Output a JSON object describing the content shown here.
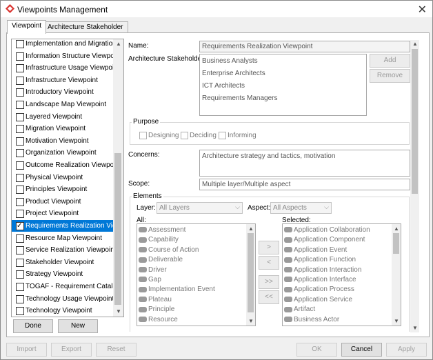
{
  "window": {
    "title": "Viewpoints Management"
  },
  "tabs": [
    "Viewpoint",
    "Architecture Stakeholder"
  ],
  "viewpoint_list": [
    {
      "label": "Implementation and Migration ...",
      "checked": false
    },
    {
      "label": "Information Structure Viewpoint",
      "checked": false
    },
    {
      "label": "Infrastructure Usage Viewpoint",
      "checked": false
    },
    {
      "label": "Infrastructure Viewpoint",
      "checked": false
    },
    {
      "label": "Introductory Viewpoint",
      "checked": false
    },
    {
      "label": "Landscape Map Viewpoint",
      "checked": false
    },
    {
      "label": "Layered Viewpoint",
      "checked": false
    },
    {
      "label": "Migration Viewpoint",
      "checked": false
    },
    {
      "label": "Motivation Viewpoint",
      "checked": false
    },
    {
      "label": "Organization Viewpoint",
      "checked": false
    },
    {
      "label": "Outcome Realization Viewpoint",
      "checked": false
    },
    {
      "label": "Physical Viewpoint",
      "checked": false
    },
    {
      "label": "Principles Viewpoint",
      "checked": false
    },
    {
      "label": "Product Viewpoint",
      "checked": false
    },
    {
      "label": "Project Viewpoint",
      "checked": false
    },
    {
      "label": "Requirements Realization View...",
      "checked": true,
      "selected": true
    },
    {
      "label": "Resource Map Viewpoint",
      "checked": false
    },
    {
      "label": "Service Realization Viewpoint",
      "checked": false
    },
    {
      "label": "Stakeholder Viewpoint",
      "checked": false
    },
    {
      "label": "Strategy Viewpoint",
      "checked": false
    },
    {
      "label": "TOGAF - Requirement Catalog",
      "checked": false
    },
    {
      "label": "Technology Usage Viewpoint",
      "checked": false
    },
    {
      "label": "Technology Viewpoint",
      "checked": false
    }
  ],
  "list_buttons": {
    "done": "Done",
    "new": "New"
  },
  "form": {
    "name_label": "Name:",
    "name_value": "Requirements Realization Viewpoint",
    "stakeholders_label": "Architecture Stakeholders:",
    "stakeholders": [
      "Business Analysts",
      "Enterprise Architects",
      "ICT Architects",
      "Requirements Managers"
    ],
    "add": "Add",
    "remove": "Remove",
    "purpose_label": "Purpose",
    "purpose": [
      "Designing",
      "Deciding",
      "Informing"
    ],
    "concerns_label": "Concerns:",
    "concerns_value": "Architecture strategy and tactics, motivation",
    "scope_label": "Scope:",
    "scope_value": "Multiple layer/Multiple aspect",
    "elements_label": "Elements",
    "layer_label": "Layer:",
    "layer_value": "All Layers",
    "aspect_label": "Aspect:",
    "aspect_value": "All Aspects",
    "all_label": "All:",
    "selected_label": "Selected:",
    "all_items": [
      "Assessment",
      "Capability",
      "Course of Action",
      "Deliverable",
      "Driver",
      "Gap",
      "Implementation Event",
      "Plateau",
      "Principle",
      "Resource"
    ],
    "selected_items": [
      "Application Collaboration",
      "Application Component",
      "Application Event",
      "Application Function",
      "Application Interaction",
      "Application Interface",
      "Application Process",
      "Application Service",
      "Artifact",
      "Business Actor"
    ],
    "move": [
      ">",
      "<",
      ">>",
      "<<"
    ]
  },
  "bottom_buttons": {
    "import": "Import",
    "export": "Export",
    "reset": "Reset",
    "ok": "OK",
    "cancel": "Cancel",
    "apply": "Apply"
  }
}
